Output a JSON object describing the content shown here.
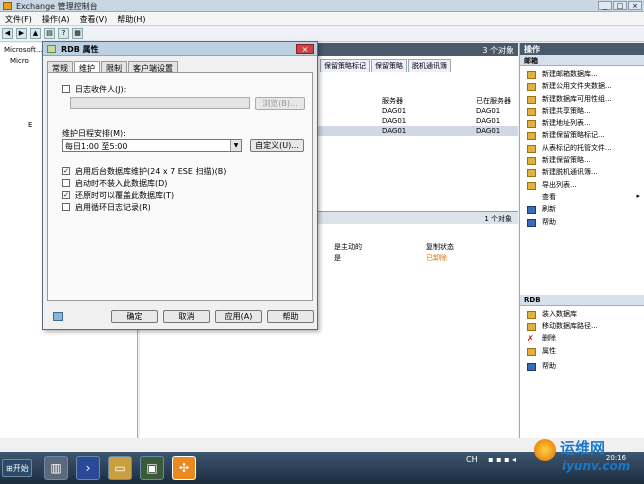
{
  "app": {
    "title": "Exchange 管理控制台"
  },
  "menu": [
    "文件(F)",
    "操作(A)",
    "查看(V)",
    "帮助(H)"
  ],
  "tree": {
    "root": "Microsoft...",
    "item1": "Micro",
    "item2": "E"
  },
  "center": {
    "count_top": "3 个对象",
    "tabs": [
      "保留策略标记",
      "保留策略",
      "脱机通讯簿"
    ],
    "col_server": "服务器",
    "col_mounted": "已在服务器",
    "rows": [
      {
        "server": "DAG01",
        "mounted": "DAG01"
      },
      {
        "server": "DAG01",
        "mounted": "DAG01"
      },
      {
        "server": "DAG01",
        "mounted": "DAG01"
      }
    ],
    "count_bottom": "1 个对象",
    "col_active": "是主动的",
    "col_copy": "复制状态",
    "row_active": "是",
    "row_copy": "已卸除"
  },
  "actions": {
    "header": "操作",
    "section1": "邮箱",
    "items1": [
      "新建邮箱数据库...",
      "新建公用文件夹数据...",
      "新建数据库可用性组...",
      "新建共享策略...",
      "新建地址列表...",
      "新建保留策略标记...",
      "从表标记的托管文件...",
      "新建保留策略...",
      "新建脱机通讯簿...",
      "导出列表...",
      "查看",
      "刷新",
      "帮助"
    ],
    "section2": "RDB",
    "items2": [
      "装入数据库",
      "移动数据库路径...",
      "删除",
      "属性",
      "帮助"
    ]
  },
  "dialog": {
    "title": "RDB 属性",
    "tabs": [
      "常规",
      "维护",
      "限制",
      "客户端设置"
    ],
    "active_tab": "维护",
    "journal_label": "日志收件人(J):",
    "browse": "浏览(B)...",
    "schedule_label": "维护日程安排(M):",
    "schedule_value": "每日1:00 至5:00",
    "customize": "自定义(U)...",
    "options": [
      {
        "label": "启用后台数据库维护(24 x 7 ESE 扫描)(B)",
        "checked": true
      },
      {
        "label": "启动时不装入此数据库(D)",
        "checked": false
      },
      {
        "label": "还原时可以覆盖此数据库(T)",
        "checked": true
      },
      {
        "label": "启用循环日志记录(R)",
        "checked": false
      }
    ],
    "ok": "确定",
    "cancel": "取消",
    "apply": "应用(A)",
    "help": "帮助"
  },
  "taskbar": {
    "start": "开始",
    "lang": "CH",
    "clock": "20:16"
  },
  "watermark": {
    "text1": "运维网",
    "text2": "iyunv.com"
  }
}
